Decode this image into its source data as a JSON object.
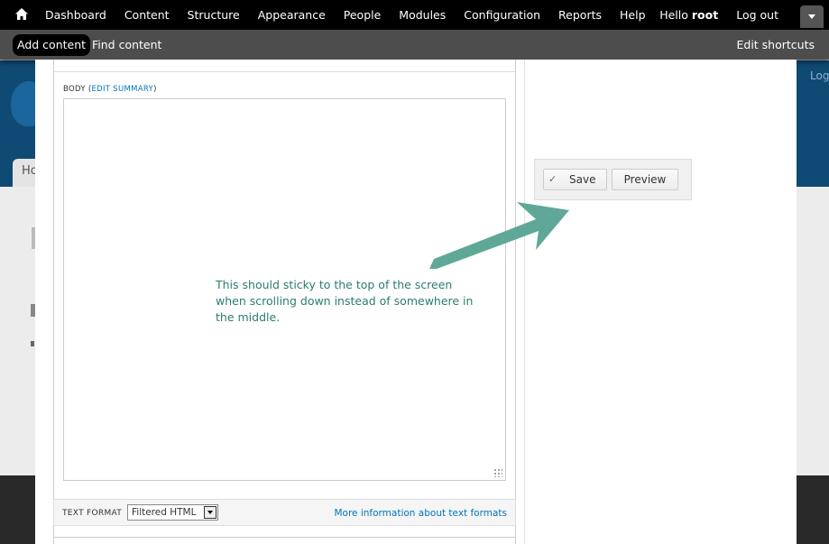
{
  "toolbar": {
    "menu": [
      "Dashboard",
      "Content",
      "Structure",
      "Appearance",
      "People",
      "Modules",
      "Configuration",
      "Reports",
      "Help"
    ],
    "hello_prefix": "Hello ",
    "username": "root",
    "logout": "Log out"
  },
  "shortcuts": {
    "add_content": "Add content",
    "find_content": "Find content",
    "edit_shortcuts": "Edit shortcuts"
  },
  "background": {
    "tab_label": "Ho",
    "login_text": "Log"
  },
  "form": {
    "body_label": "Body",
    "edit_summary": "Edit summary",
    "text_format_label": "TEXT FORMAT",
    "text_format_value": "Filtered HTML",
    "format_info_link": "More information about text formats"
  },
  "actions": {
    "save": "Save",
    "preview": "Preview"
  },
  "annotation": {
    "text": "This should sticky to the top of the screen when scrolling down instead of somewhere in the middle.",
    "color": "#5fa898"
  },
  "colors": {
    "link": "#0074bd",
    "toolbar": "#000000",
    "shortcut_bar": "#4d4d4d"
  }
}
